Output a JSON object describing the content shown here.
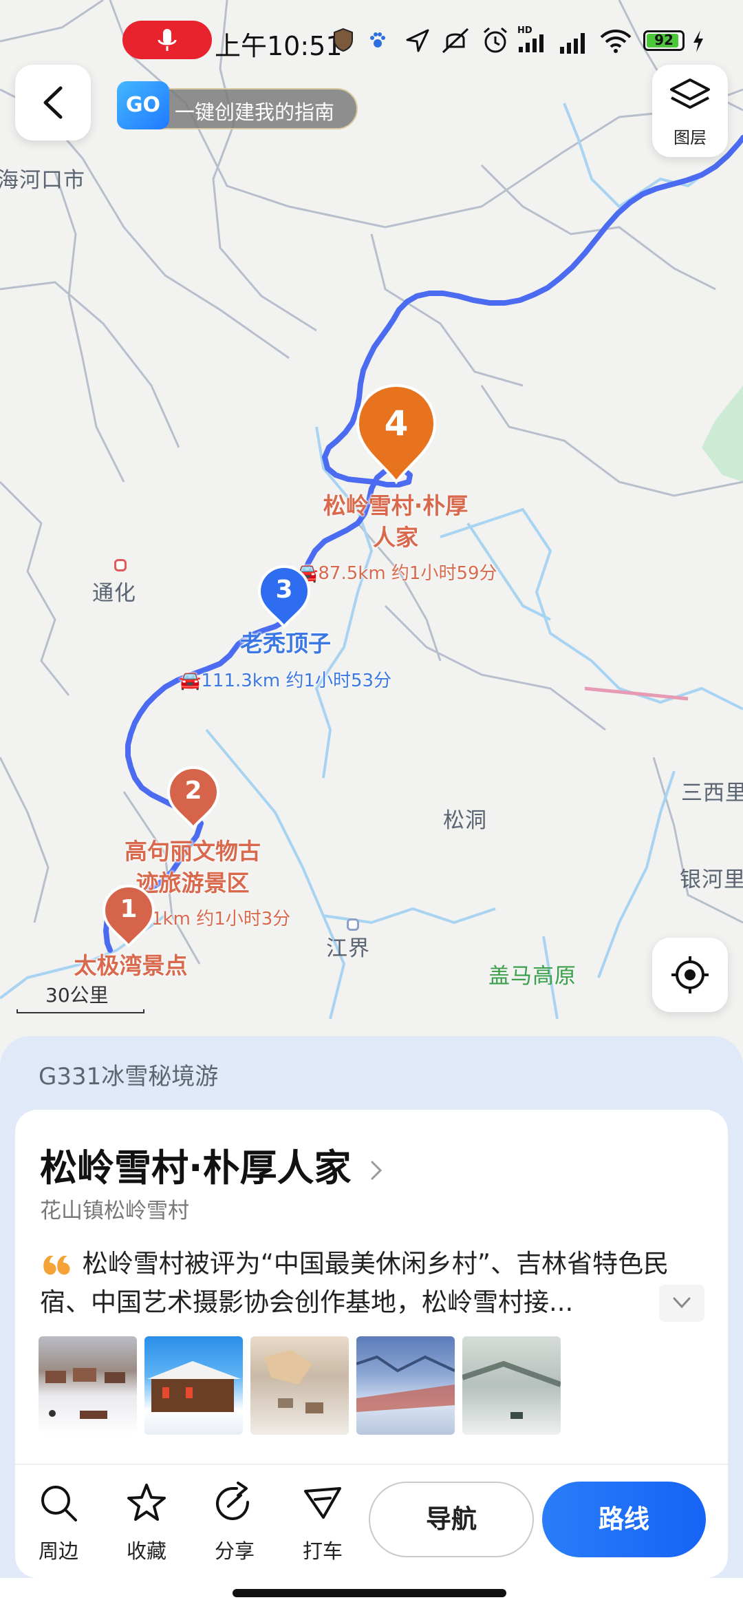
{
  "status_bar": {
    "time": "上午10:51",
    "battery": 92,
    "icons": [
      "microphone-recording-icon",
      "shield-icon",
      "paw-icon",
      "location-arrow-icon",
      "mute-vibrate-icon",
      "alarm-icon",
      "hd-signal-icon",
      "signal-icon",
      "wifi-icon",
      "battery-icon",
      "charging-icon"
    ]
  },
  "map_controls": {
    "go_badge": "GO",
    "guide_button": "一键创建我的指南",
    "layers_label": "图层",
    "scale_label": "30公里"
  },
  "map_labels": {
    "city_1": "海河口市",
    "city_2": "通化",
    "place_songdong": "松洞",
    "place_jiangjie": "江界",
    "place_sanxili": "三西里",
    "place_yinheli": "银河里",
    "place_gaima": "盖马高原"
  },
  "route_stops": [
    {
      "num": "1",
      "name": "太极湾景点",
      "distance": "1km 约1小时3分"
    },
    {
      "num": "2",
      "name": "高句丽文物古迹旅游景区",
      "name_line1": "高句丽文物古",
      "name_line2": "迹旅游景区"
    },
    {
      "num": "3",
      "name": "老秃顶子",
      "distance": "111.3km 约1小时53分"
    },
    {
      "num": "4",
      "name_line1": "松岭雪村·朴厚",
      "name_line2": "人家",
      "distance": "87.5km 约1小时59分"
    }
  ],
  "colors": {
    "route_line": "#4d6ef2",
    "stop_red": "#d6644a",
    "stop_orange": "#e8731f",
    "stop_blue": "#2f6df0",
    "primary_button": "#1f6ff6"
  },
  "sheet": {
    "route_title": "G331冰雪秘境游",
    "poi_title": "松岭雪村·朴厚人家",
    "address": "花山镇松岭雪村",
    "description": "松岭雪村被评为“中国最美休闲乡村”、吉林省特色民宿、中国艺术摄影协会创作基地，松岭雪村接...",
    "photos": [
      "snow-village-photo",
      "wooden-house-photo",
      "aerial-village-photo",
      "snow-forest-photo",
      "snowy-road-photo"
    ]
  },
  "actions": {
    "nearby": "周边",
    "favorite": "收藏",
    "share": "分享",
    "taxi": "打车",
    "navigate": "导航",
    "route": "路线"
  }
}
